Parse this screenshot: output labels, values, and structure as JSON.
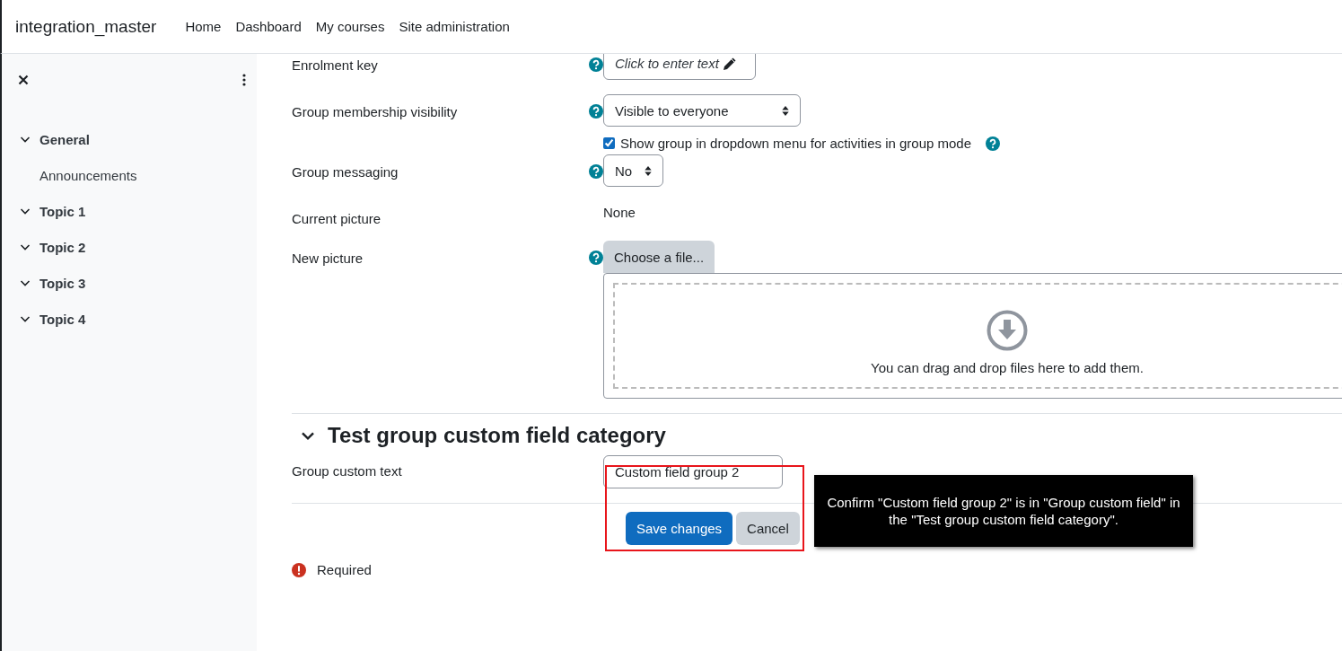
{
  "site_name": "integration_master",
  "nav_links": [
    {
      "label": "Home"
    },
    {
      "label": "Dashboard"
    },
    {
      "label": "My courses"
    },
    {
      "label": "Site administration"
    }
  ],
  "drawer": {
    "items": [
      {
        "label": "General",
        "expanded": true,
        "children": [
          {
            "label": "Announcements"
          }
        ]
      },
      {
        "label": "Topic 1",
        "expanded": true
      },
      {
        "label": "Topic 2",
        "expanded": true
      },
      {
        "label": "Topic 3",
        "expanded": true
      },
      {
        "label": "Topic 4",
        "expanded": true
      }
    ]
  },
  "fields": [
    {
      "kind": "editable",
      "label": "Enrolment key",
      "help": true,
      "placeholder": "Click to enter text"
    },
    {
      "kind": "select",
      "label": "Group membership visibility",
      "help": true,
      "value": "Visible to everyone"
    },
    {
      "kind": "checkbox",
      "label": "Show group in dropdown menu for activities in group mode",
      "help": true,
      "checked": true
    },
    {
      "kind": "select",
      "label": "Group messaging",
      "help": true,
      "value": "No"
    },
    {
      "kind": "static",
      "label": "Current picture",
      "help": false,
      "value": "None"
    },
    {
      "kind": "filepicker",
      "label": "New picture",
      "help": true,
      "button": "Choose a file...",
      "drop_hint": "You can drag and drop files here to add them."
    }
  ],
  "section": {
    "title": "Test group custom field category",
    "expanded": true,
    "fields": [
      {
        "kind": "text",
        "label": "Group custom text",
        "value": "Custom field group 2"
      }
    ]
  },
  "buttons": [
    {
      "label": "Save changes",
      "kind": "primary"
    },
    {
      "label": "Cancel",
      "kind": "secondary"
    }
  ],
  "required_note": "Required",
  "tour_tip": {
    "text": "Confirm \"Custom field group 2\" is in \"Group custom field\" in the \"Test group custom field category\"."
  }
}
